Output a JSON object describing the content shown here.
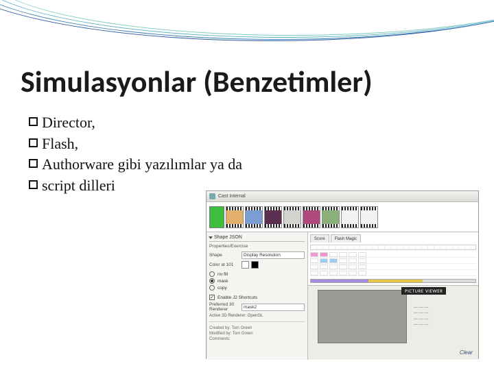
{
  "slide": {
    "title": "Simulasyonlar (Benzetimler)",
    "bullets": [
      "Director,",
      "Flash,",
      "Authorware gibi yazılımlar ya da",
      " script dilleri"
    ]
  },
  "app": {
    "window_title": "Cast Internal",
    "panel": {
      "header": "Shape JSON",
      "group_label": "Properties/Exercise",
      "shape_label": "Shape",
      "shape_value": "Display Resolution",
      "color_label": "Color at 101",
      "fill_options": [
        "no fill",
        "mask",
        "copy"
      ],
      "fill_selected": "mask",
      "checkbox_label": "Enable J2 Shortcuts",
      "prefer_label": "Preferred 30 Renderer",
      "prefer_value": "mask2",
      "section2": "Active 3D Renderer: OpenGL",
      "meta_lines": [
        "Created by:",
        "Modified by:",
        "Comments:"
      ],
      "meta_values": [
        "Tom Green",
        "Tom Green",
        ""
      ]
    },
    "timeline": {
      "tabs": [
        "Score",
        "Flash Magic"
      ]
    },
    "stage": {
      "banner": "PICTURE VIEWER",
      "clear": "Clear"
    }
  }
}
